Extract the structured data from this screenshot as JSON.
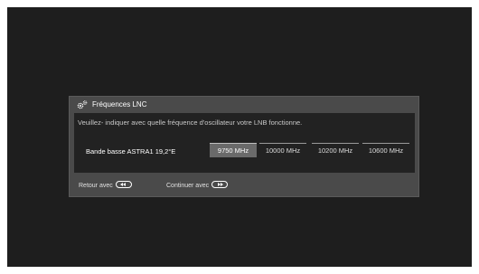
{
  "dialog": {
    "title": "Fréquences LNC",
    "icon": "gear-icon"
  },
  "content": {
    "instruction": "Veuillez- indiquer avec quelle fréquence d'oscillateur votre LNB fonctionne.",
    "band_label": "Bande basse ASTRA1 19,2°E",
    "options": [
      {
        "label": "9750 MHz",
        "selected": true
      },
      {
        "label": "10000 MHz",
        "selected": false
      },
      {
        "label": "10200 MHz",
        "selected": false
      },
      {
        "label": "10600 MHz",
        "selected": false
      }
    ]
  },
  "footer": {
    "back_label": "Retour avec",
    "back_icon": "rewind-button-icon",
    "continue_label": "Continuer avec",
    "continue_icon": "fast-forward-button-icon"
  }
}
